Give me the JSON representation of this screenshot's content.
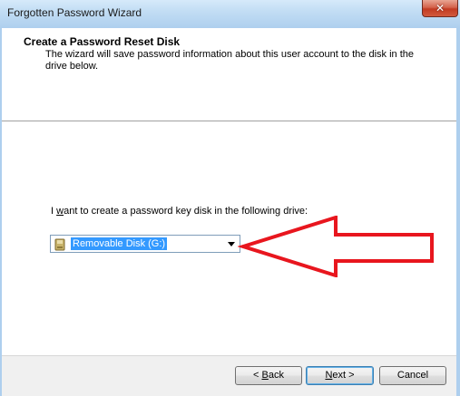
{
  "window": {
    "title": "Forgotten Password Wizard",
    "close_label": "✕"
  },
  "header": {
    "title": "Create a Password Reset Disk",
    "description": "The wizard will save password information about this user account to the disk in the drive below."
  },
  "drive_selection": {
    "label_prefix": "I ",
    "label_mnemonic": "w",
    "label_suffix": "ant to create a password key disk in the following drive:",
    "selected_value": "Removable Disk (G:)",
    "icon": "removable-disk-icon"
  },
  "annotation": {
    "arrow_color": "#e8161e",
    "direction": "left"
  },
  "footer": {
    "back_mnemonic": "B",
    "back_rest": "ack",
    "back_prefix": "< ",
    "next_mnemonic": "N",
    "next_rest": "ext >",
    "cancel_label": "Cancel"
  },
  "colors": {
    "titlebar": "#c2ddf4",
    "selection_highlight": "#3399ff",
    "default_button_border": "#3c7fb1"
  }
}
